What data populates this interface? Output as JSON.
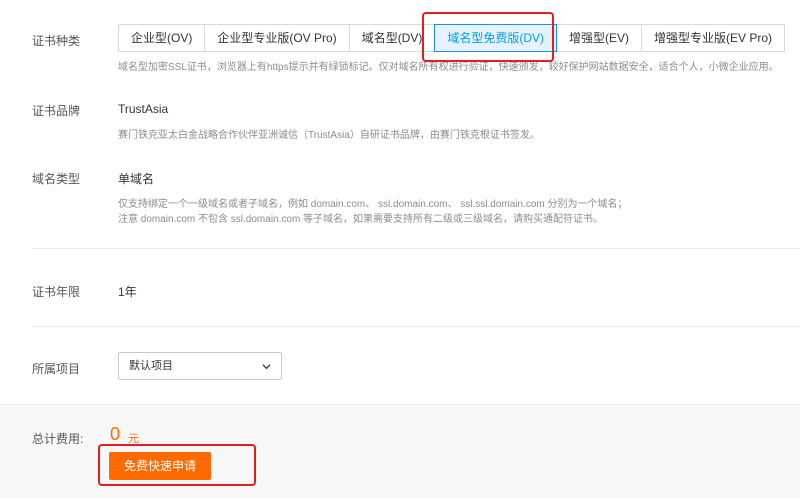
{
  "cert_type": {
    "label": "证书种类",
    "options": [
      "企业型(OV)",
      "企业型专业版(OV Pro)",
      "域名型(DV)",
      "域名型免费版(DV)",
      "增强型(EV)",
      "增强型专业版(EV Pro)"
    ],
    "selected": "域名型免费版(DV)",
    "hint": "域名型加密SSL证书，浏览器上有https提示并有绿锁标记。仅对域名所有权进行验证，快速颁发，较好保护网站数据安全，适合个人，小微企业应用。"
  },
  "brand": {
    "label": "证书品牌",
    "value": "TrustAsia",
    "hint": "赛门铁克亚太白金战略合作伙伴亚洲诚信（TrustAsia）自研证书品牌，由赛门铁克根证书签发。"
  },
  "domain_type": {
    "label": "域名类型",
    "value": "单域名",
    "hint_line1": "仅支持绑定一个一级域名或者子域名，例如 domain.com、 ssl.domain.com、 ssl.ssl.domain.com 分别为一个域名；",
    "hint_line2": "注意 domain.com 不包含 ssl.domain.com 等子域名，如果需要支持所有二级或三级域名，请购买通配符证书。"
  },
  "validity": {
    "label": "证书年限",
    "value": "1年"
  },
  "project": {
    "label": "所属项目",
    "selected": "默认项目"
  },
  "footer": {
    "total_label": "总计费用:",
    "price": "0",
    "unit": "元",
    "apply_button": "免费快速申请"
  },
  "colors": {
    "accent_orange": "#ff6a00",
    "active_blue": "#00a0e9",
    "highlight_red": "#e02020"
  },
  "icons": {
    "select_chevron": "chevron-down-icon"
  }
}
